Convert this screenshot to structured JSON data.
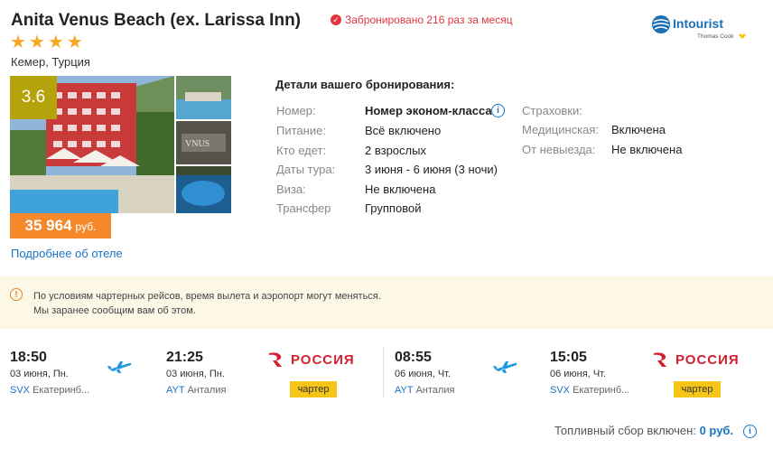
{
  "hotel": {
    "name": "Anita Venus Beach (ex. Larissa Inn)",
    "booked_text": "Забронировано 216 раз за месяц",
    "stars": 4,
    "location": "Кемер, Турция",
    "rating": "3.6",
    "price_value": "35 964",
    "price_currency": "руб.",
    "more_link": "Подробнее об отеле"
  },
  "logo": {
    "brand": "Intourist",
    "sub": "Thomas Cook"
  },
  "details": {
    "title": "Детали вашего бронирования:",
    "rows": [
      {
        "label": "Номер:",
        "value": "Номер эконом-класса"
      },
      {
        "label": "Питание:",
        "value": "Всё включено"
      },
      {
        "label": "Кто едет:",
        "value": "2 взрослых"
      },
      {
        "label": "Даты тура:",
        "value": "3 июня - 6 июня (3 ночи)"
      },
      {
        "label": "Виза:",
        "value": "Не включена"
      },
      {
        "label": "Трансфер",
        "value": "Групповой"
      }
    ],
    "insurance": [
      {
        "label": "Страховки:",
        "value": ""
      },
      {
        "label": "Медицинская:",
        "value": "Включена"
      },
      {
        "label": "От невыезда:",
        "value": "Не включена"
      }
    ]
  },
  "notice": {
    "line1": "По условиям чартерных рейсов, время вылета и аэропорт могут меняться.",
    "line2": "Мы заранее сообщим вам об этом."
  },
  "flights": [
    {
      "dep_time": "18:50",
      "dep_date": "03 июня, Пн.",
      "dep_code": "SVX",
      "dep_city": "Екатеринб...",
      "arr_time": "21:25",
      "arr_date": "03 июня, Пн.",
      "arr_code": "AYT",
      "arr_city": "Анталия",
      "airline": "РОССИЯ",
      "type": "чартер"
    },
    {
      "dep_time": "08:55",
      "dep_date": "06 июня, Чт.",
      "dep_code": "AYT",
      "dep_city": "Анталия",
      "arr_time": "15:05",
      "arr_date": "06 июня, Чт.",
      "arr_code": "SVX",
      "arr_city": "Екатеринб...",
      "airline": "РОССИЯ",
      "type": "чартер"
    }
  ],
  "fuel": {
    "label": "Топливный сбор включен:",
    "value": "0 руб."
  },
  "colors": {
    "accent_blue": "#1874c5",
    "price_orange": "#f5892c",
    "rating_olive": "#b5a30b",
    "airline_red": "#d3202e",
    "charter_yellow": "#f5c518"
  }
}
